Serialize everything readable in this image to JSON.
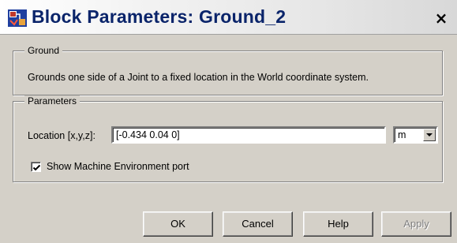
{
  "window": {
    "title": "Block Parameters: Ground_2",
    "close_glyph": "×",
    "icon": "simulink-block-icon"
  },
  "ground_group": {
    "legend": "Ground",
    "description": "Grounds one side of a Joint to a fixed location in the World coordinate system."
  },
  "parameters_group": {
    "legend": "Parameters",
    "location": {
      "label": "Location [x,y,z]:",
      "value": "[-0.434 0.04 0]"
    },
    "unit": {
      "selected": "m"
    },
    "show_port": {
      "label": "Show Machine Environment port",
      "checked": true
    }
  },
  "buttons": {
    "ok": "OK",
    "cancel": "Cancel",
    "help": "Help",
    "apply": "Apply",
    "apply_enabled": false
  },
  "colors": {
    "title_text": "#0a246a",
    "dialog_bg": "#d4d0c8",
    "disabled_text": "#808080"
  }
}
